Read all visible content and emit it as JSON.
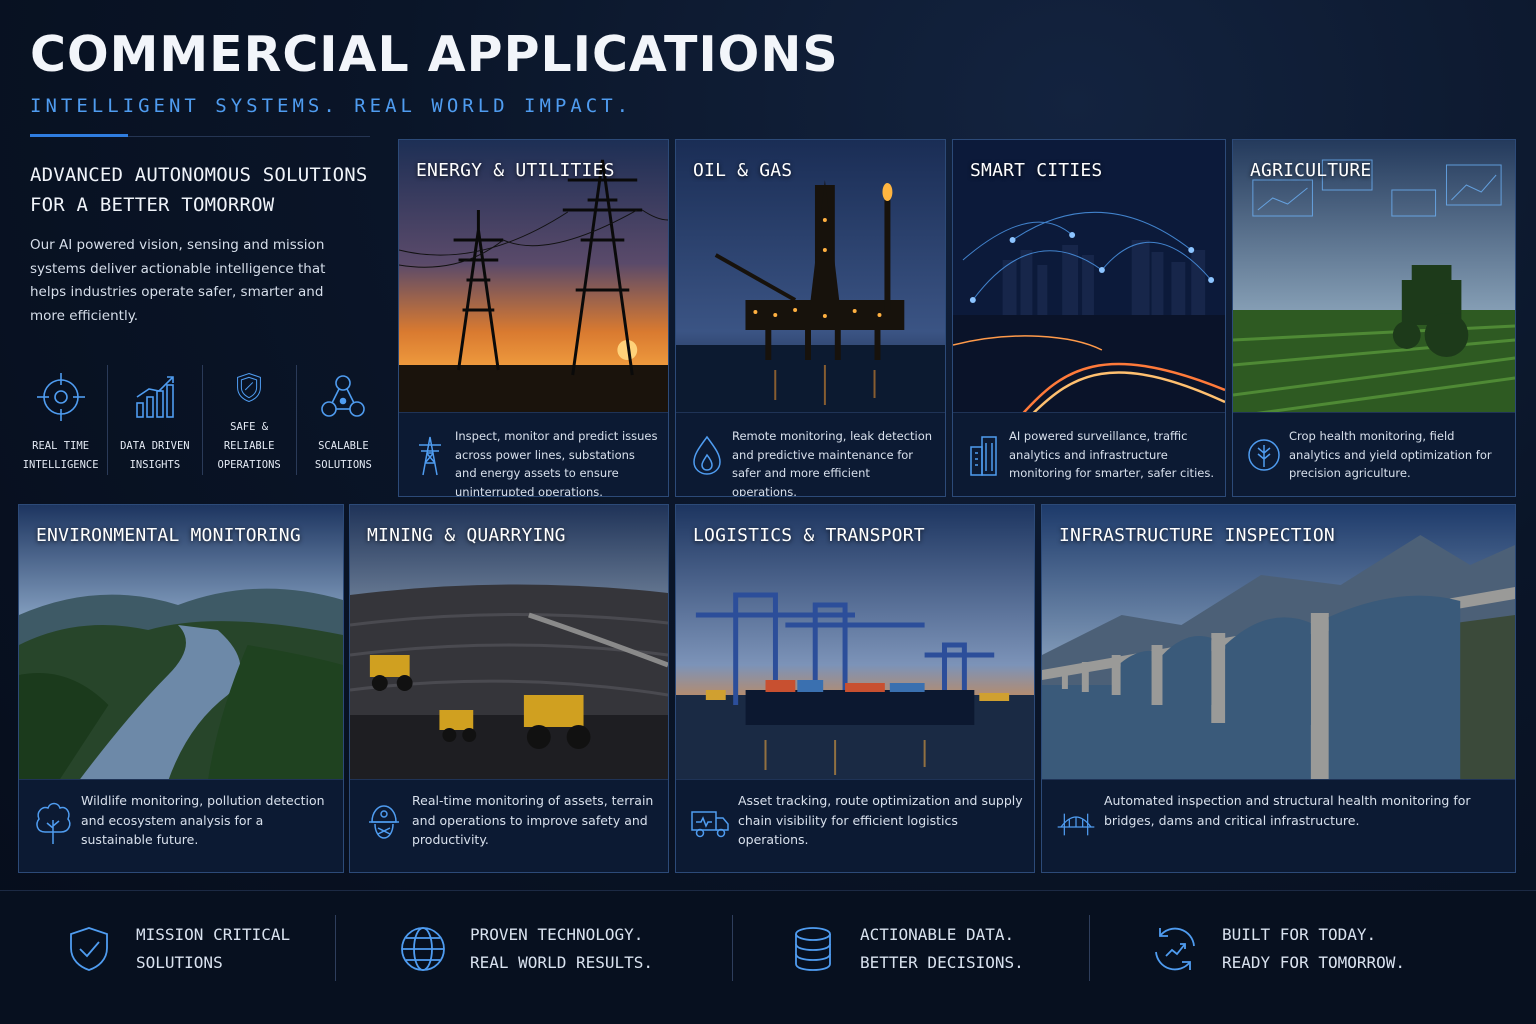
{
  "header": {
    "title": "COMMERCIAL APPLICATIONS",
    "subtitle": "INTELLIGENT SYSTEMS. REAL WORLD IMPACT."
  },
  "intro": {
    "heading": "ADVANCED AUTONOMOUS SOLUTIONS\nFOR A BETTER TOMORROW",
    "text": "Our AI powered vision, sensing and mission systems deliver actionable intelligence that helps industries operate safer, smarter and more efficiently."
  },
  "features": [
    {
      "icon": "crosshair-icon",
      "label": "REAL TIME\nINTELLIGENCE"
    },
    {
      "icon": "bar-chart-icon",
      "label": "DATA DRIVEN\nINSIGHTS"
    },
    {
      "icon": "shield-icon",
      "label": "SAFE & RELIABLE\nOPERATIONS"
    },
    {
      "icon": "network-icon",
      "label": "SCALABLE\nSOLUTIONS"
    }
  ],
  "cards": [
    {
      "title": "ENERGY & UTILITIES",
      "icon": "transmission-tower-icon",
      "text": "Inspect, monitor and predict issues across power lines, substations and energy assets to ensure uninterrupted operations."
    },
    {
      "title": "OIL & GAS",
      "icon": "flame-drop-icon",
      "text": "Remote monitoring, leak detection and predictive maintenance for safer and more efficient operations."
    },
    {
      "title": "SMART CITIES",
      "icon": "buildings-icon",
      "text": "AI powered surveillance, traffic analytics and infrastructure monitoring for smarter, safer cities."
    },
    {
      "title": "AGRICULTURE",
      "icon": "leaf-icon",
      "text": "Crop health monitoring, field analytics and yield optimization for precision agriculture."
    },
    {
      "title": "ENVIRONMENTAL MONITORING",
      "icon": "tree-icon",
      "text": "Wildlife monitoring, pollution detection and ecosystem analysis for a sustainable future."
    },
    {
      "title": "MINING & QUARRYING",
      "icon": "mining-helmet-icon",
      "text": "Real-time monitoring of assets, terrain and operations to improve safety and productivity."
    },
    {
      "title": "LOGISTICS & TRANSPORT",
      "icon": "truck-icon",
      "text": "Asset tracking, route optimization and supply chain visibility for efficient logistics operations."
    },
    {
      "title": "INFRASTRUCTURE INSPECTION",
      "icon": "bridge-icon",
      "text": "Automated inspection and structural health monitoring for bridges, dams and critical infrastructure."
    }
  ],
  "footer": [
    {
      "icon": "shield-check-icon",
      "text": "MISSION CRITICAL\nSOLUTIONS"
    },
    {
      "icon": "globe-icon",
      "text": "PROVEN TECHNOLOGY.\nREAL WORLD RESULTS."
    },
    {
      "icon": "database-icon",
      "text": "ACTIONABLE DATA.\nBETTER DECISIONS."
    },
    {
      "icon": "refresh-growth-icon",
      "text": "BUILT FOR TODAY.\nREADY FOR TOMORROW."
    }
  ],
  "colors": {
    "background": "#0a1528",
    "accent": "#4f9cf0",
    "card_border": "#2c4a78",
    "card_body": "#0c1a33"
  }
}
